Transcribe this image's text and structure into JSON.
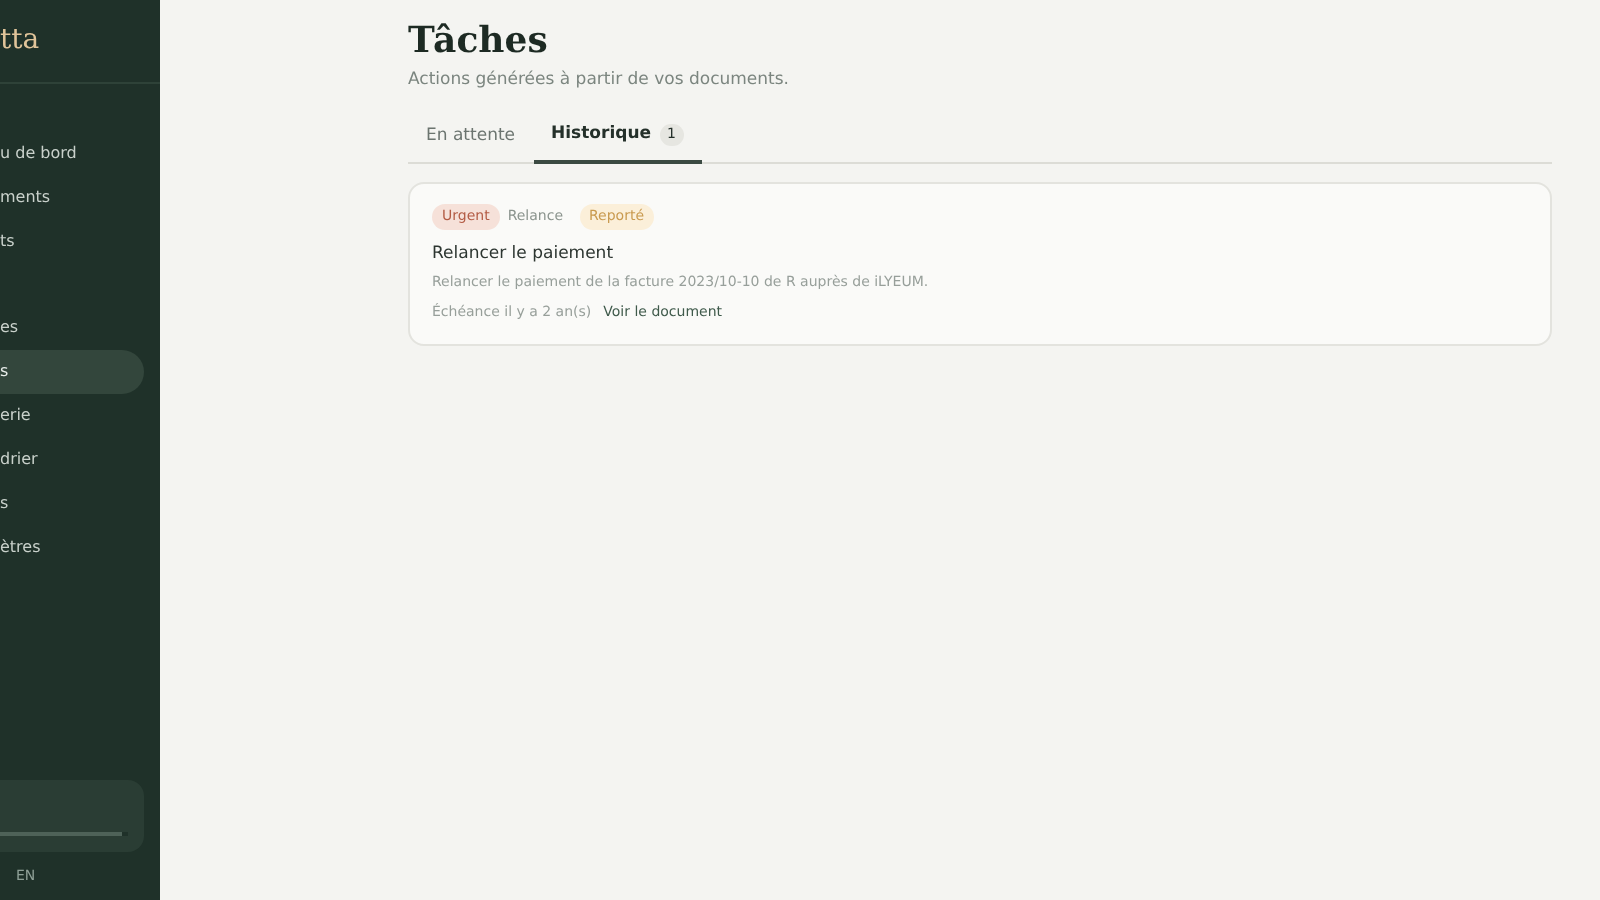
{
  "sidebar": {
    "logo": "tta",
    "items": [
      {
        "label": "u de bord",
        "selected": false
      },
      {
        "label": "ments",
        "selected": false
      },
      {
        "label": "ts",
        "selected": false
      },
      {
        "label": "es",
        "selected": false
      },
      {
        "label": "s",
        "selected": true
      },
      {
        "label": "erie",
        "selected": false
      },
      {
        "label": "drier",
        "selected": false
      },
      {
        "label": "s",
        "selected": false
      },
      {
        "label": "ètres",
        "selected": false
      }
    ],
    "usage": {
      "level": 0.95
    },
    "language": "EN"
  },
  "page": {
    "title": "Tâches",
    "subtitle": "Actions générées à partir de vos documents."
  },
  "tabs": [
    {
      "label": "En attente",
      "selected": false
    },
    {
      "label": "Historique",
      "count": "1",
      "selected": true
    }
  ],
  "tasks": [
    {
      "tags": [
        {
          "label": "Urgent",
          "kind": "urgent"
        },
        {
          "label": "Relance",
          "kind": "plain"
        },
        {
          "label": "Reporté",
          "kind": "postponed"
        }
      ],
      "title": "Relancer le paiement",
      "description": "Relancer le paiement de la facture 2023/10-10 de R auprès de iLYEUM.",
      "due": "Échéance il y a 2 an(s)",
      "link": "Voir le document"
    }
  ]
}
